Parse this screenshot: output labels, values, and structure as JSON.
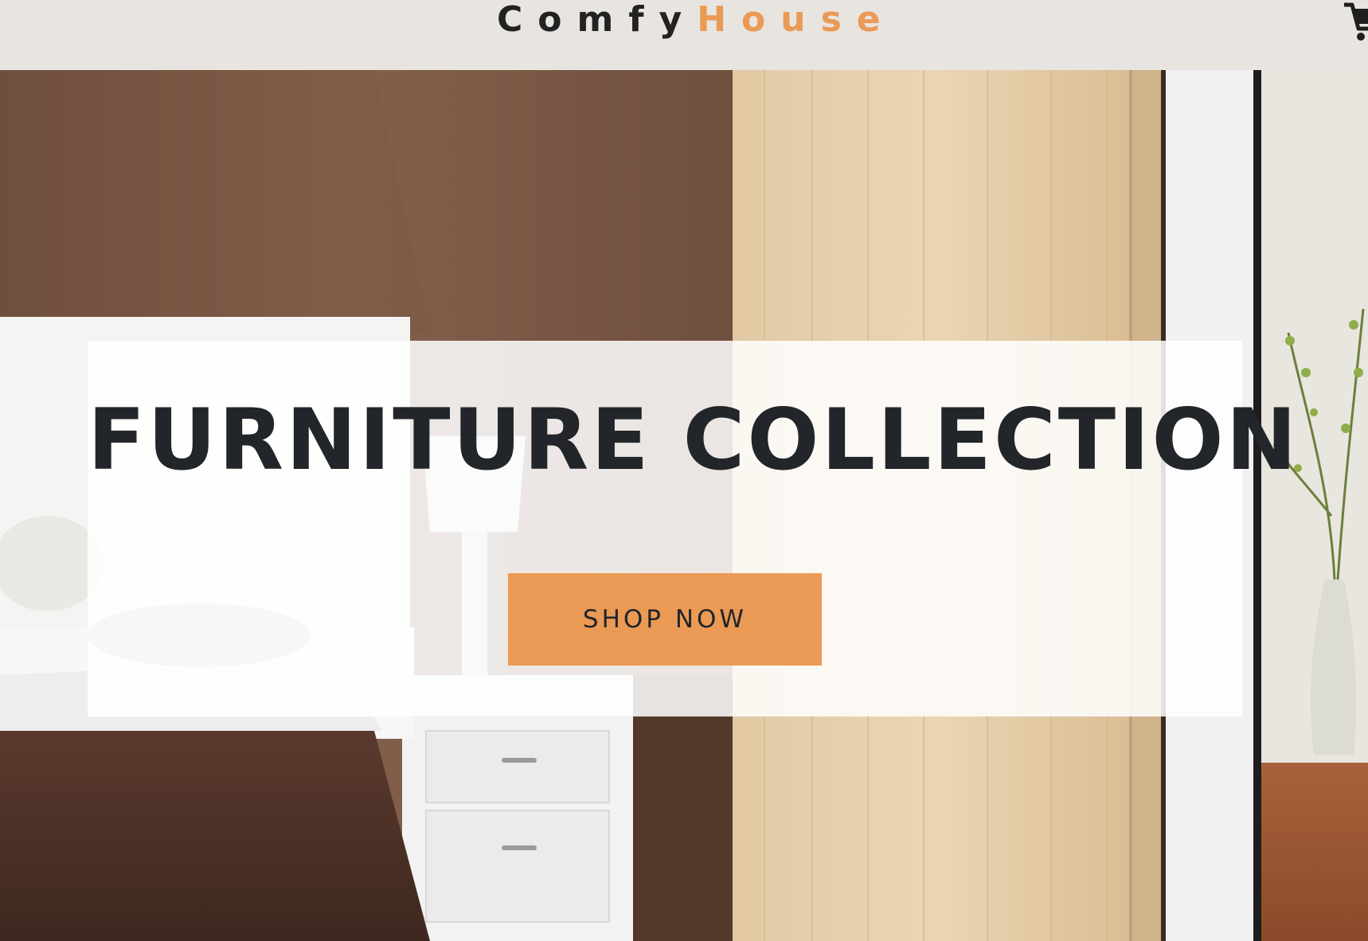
{
  "navbar": {
    "brand_part1": "Comfy",
    "brand_part2": "House",
    "cart_icon": "cart-icon"
  },
  "hero": {
    "title": "FURNITURE COLLECTION",
    "button_label": "SHOP NOW",
    "background": "bedroom-photo"
  },
  "colors": {
    "accent": "#eb9a55",
    "navbar_bg": "#e8e4e0",
    "text_dark": "#222529"
  }
}
